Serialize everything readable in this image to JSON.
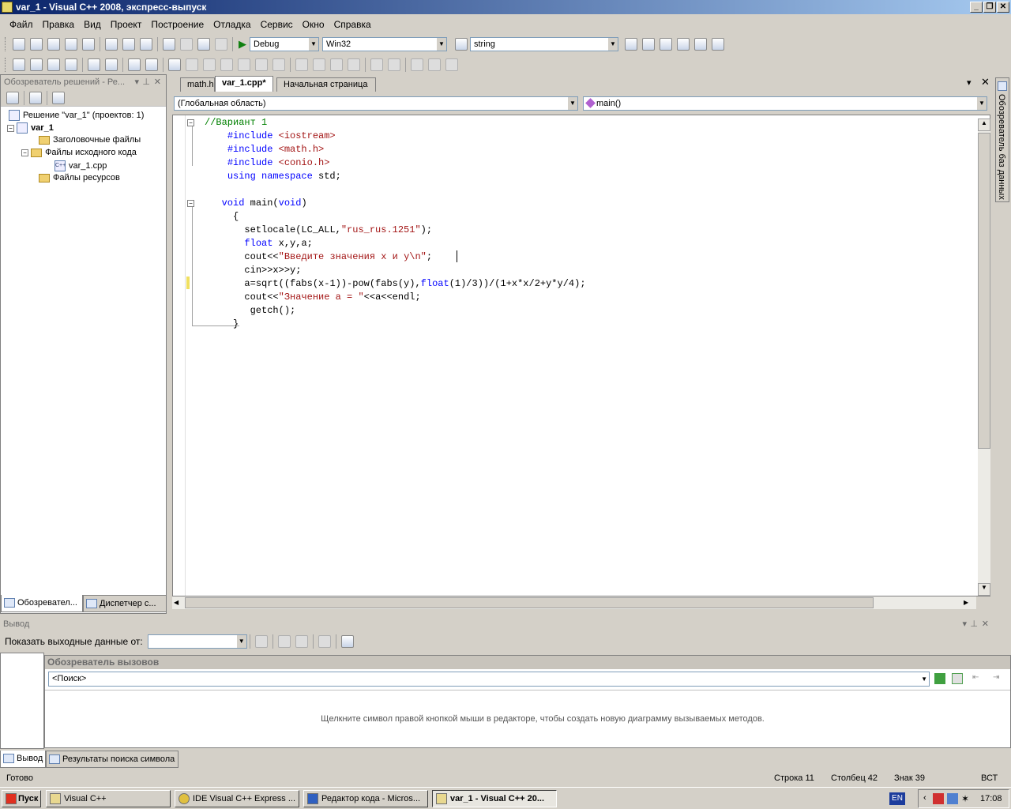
{
  "window": {
    "title": "var_1 - Visual C++ 2008, экспресс-выпуск"
  },
  "menu": [
    "Файл",
    "Правка",
    "Вид",
    "Проект",
    "Построение",
    "Отладка",
    "Сервис",
    "Окно",
    "Справка"
  ],
  "toolbar": {
    "config": "Debug",
    "platform": "Win32",
    "find_value": "string"
  },
  "solution_explorer": {
    "title": "Обозреватель решений - Ре...",
    "items": [
      "Решение \"var_1\" (проектов: 1)",
      "var_1",
      "Заголовочные файлы",
      "Файлы исходного кода",
      "var_1.cpp",
      "Файлы ресурсов"
    ],
    "tabs": [
      "Обозревател...",
      "Диспетчер с..."
    ]
  },
  "right_sidebar": {
    "label": "Обозреватель баз данных"
  },
  "editor": {
    "tabs": [
      "math.h",
      "var_1.cpp*",
      "Начальная страница"
    ],
    "scope": "(Глобальная область)",
    "member": "main()",
    "lines": [
      {
        "indent": "",
        "parts": [
          {
            "t": "//Вариант 1",
            "c": "cm"
          }
        ]
      },
      {
        "indent": "    ",
        "parts": [
          {
            "t": "#include ",
            "c": "kw"
          },
          {
            "t": "<iostream>",
            "c": "st"
          }
        ]
      },
      {
        "indent": "    ",
        "parts": [
          {
            "t": "#include ",
            "c": "kw"
          },
          {
            "t": "<math.h>",
            "c": "st"
          }
        ]
      },
      {
        "indent": "    ",
        "parts": [
          {
            "t": "#include ",
            "c": "kw"
          },
          {
            "t": "<conio.h>",
            "c": "st"
          }
        ]
      },
      {
        "indent": "    ",
        "parts": [
          {
            "t": "using namespace ",
            "c": "kw"
          },
          {
            "t": "std;",
            "c": ""
          }
        ]
      },
      {
        "indent": "",
        "parts": []
      },
      {
        "indent": "   ",
        "parts": [
          {
            "t": "void ",
            "c": "kw"
          },
          {
            "t": "main(",
            "c": ""
          },
          {
            "t": "void",
            "c": "kw"
          },
          {
            "t": ")",
            "c": ""
          }
        ]
      },
      {
        "indent": "     ",
        "parts": [
          {
            "t": "{",
            "c": ""
          }
        ]
      },
      {
        "indent": "       ",
        "parts": [
          {
            "t": "setlocale(LC_ALL,",
            "c": ""
          },
          {
            "t": "\"rus_rus.1251\"",
            "c": "st"
          },
          {
            "t": ");",
            "c": ""
          }
        ]
      },
      {
        "indent": "       ",
        "parts": [
          {
            "t": "float ",
            "c": "kw"
          },
          {
            "t": "x,y,a;",
            "c": ""
          }
        ]
      },
      {
        "indent": "       ",
        "parts": [
          {
            "t": "cout<<",
            "c": ""
          },
          {
            "t": "\"Введите значения x и y\\n\"",
            "c": "st"
          },
          {
            "t": ";",
            "c": ""
          }
        ]
      },
      {
        "indent": "       ",
        "parts": [
          {
            "t": "cin>>x>>y;",
            "c": ""
          }
        ]
      },
      {
        "indent": "       ",
        "parts": [
          {
            "t": "a=sqrt((fabs(x-1))-pow(fabs(y),",
            "c": ""
          },
          {
            "t": "float",
            "c": "kw"
          },
          {
            "t": "(1)/3))/(1+x*x/2+y*y/4);",
            "c": ""
          }
        ]
      },
      {
        "indent": "       ",
        "parts": [
          {
            "t": "cout<<",
            "c": ""
          },
          {
            "t": "\"Значение a = \"",
            "c": "st"
          },
          {
            "t": "<<a<<endl;",
            "c": ""
          }
        ]
      },
      {
        "indent": "        ",
        "parts": [
          {
            "t": "getch();",
            "c": ""
          }
        ]
      },
      {
        "indent": "     ",
        "parts": [
          {
            "t": "}",
            "c": ""
          }
        ]
      }
    ]
  },
  "output": {
    "title": "Вывод",
    "show_from_label": "Показать выходные данные от:",
    "tabs": [
      "Вывод",
      "Результаты поиска символа"
    ]
  },
  "call_browser": {
    "title": "Обозреватель вызовов",
    "search": "<Поиск>",
    "hint": "Щелкните символ правой кнопкой мыши в редакторе, чтобы создать новую диаграмму вызываемых методов."
  },
  "status": {
    "ready": "Готово",
    "line": "Строка 11",
    "col": "Столбец 42",
    "char": "Знак 39",
    "mode": "ВСТ"
  },
  "taskbar": {
    "start": "Пуск",
    "tasks": [
      "Visual C++",
      "IDE Visual C++ Express ...",
      "Редактор кода - Micros...",
      "var_1 - Visual C++ 20..."
    ],
    "lang": "EN",
    "time": "17:08"
  }
}
